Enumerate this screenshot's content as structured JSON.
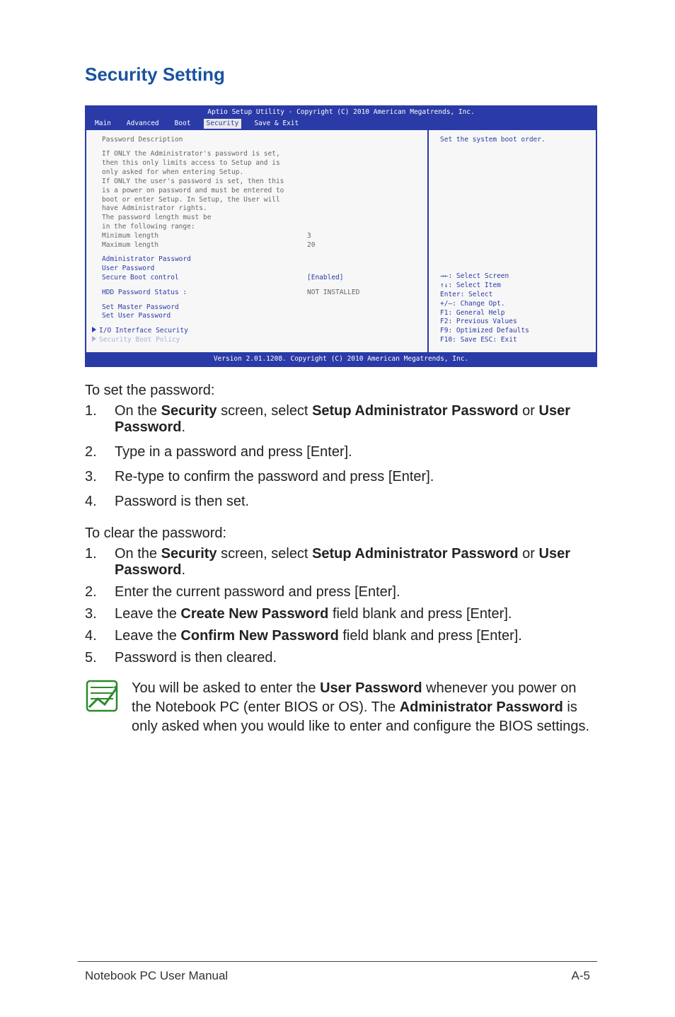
{
  "title": "Security Setting",
  "bios": {
    "header_title": "Aptio Setup Utility - Copyright (C) 2010 American Megatrends, Inc.",
    "menu": [
      "Main",
      "Advanced",
      "Boot",
      "Security",
      "Save & Exit"
    ],
    "active_tab": "Security",
    "left": {
      "heading": "Password Description",
      "desc_lines": [
        "If ONLY the Administrator's password is set,",
        "then this only limits access to Setup and is",
        "only asked for when entering Setup.",
        "If ONLY the user's password is set, then this",
        "is a power on password and must be entered to",
        "boot or enter Setup. In Setup, the User will",
        "have Administrator rights.",
        "The password length must be",
        "in the following range:"
      ],
      "min_label": "Minimum length",
      "min_value": "3",
      "max_label": "Maximum length",
      "max_value": "20",
      "items": [
        "Administrator Password",
        "User Password"
      ],
      "secure_boot_label": "Secure Boot control",
      "secure_boot_value": "[Enabled]",
      "hdd_label": "HDD Password Status :",
      "hdd_value": "NOT INSTALLED",
      "set_master": "Set Master Password",
      "set_user": "Set User Password",
      "io_sec": "I/O Interface Security",
      "boot_policy": "Security Boot Policy"
    },
    "right": {
      "top": "Set the system boot order.",
      "keys": [
        "→←: Select Screen",
        "↑↓:   Select Item",
        "Enter: Select",
        "+/—:  Change Opt.",
        "F1:   General Help",
        "F2:   Previous Values",
        "F9:   Optimized Defaults",
        "F10:  Save   ESC: Exit"
      ]
    },
    "footer": "Version 2.01.1208. Copyright (C) 2010 American Megatrends, Inc."
  },
  "set_lead": "To set the password:",
  "set_steps": {
    "s1a": "On the ",
    "s1b": "Security",
    "s1c": " screen, select ",
    "s1d": "Setup Administrator Password",
    "s1e": " or ",
    "s1f": "User Password",
    "s1g": ".",
    "s2": "Type in a password and press [Enter].",
    "s3": "Re-type to confirm the password and press [Enter].",
    "s4": "Password is then set."
  },
  "clear_lead": "To clear the password:",
  "clear_steps": {
    "s1a": "On the ",
    "s1b": "Security",
    "s1c": " screen, select ",
    "s1d": "Setup Administrator Password",
    "s1e": " or ",
    "s1f": "User Password",
    "s1g": ".",
    "s2": "Enter the current password and press [Enter].",
    "s3a": "Leave the ",
    "s3b": "Create New Password",
    "s3c": " field blank and press [Enter].",
    "s4a": "Leave the ",
    "s4b": "Confirm New Password",
    "s4c": " field blank and press [Enter].",
    "s5": "Password is then cleared."
  },
  "note": {
    "p1": "You will be asked to enter the ",
    "b1": "User Password",
    "p2": " whenever you power on the Notebook PC (enter BIOS or OS). The ",
    "b2": "Administrator Password",
    "p3": " is only asked when you would like to enter and configure the BIOS settings."
  },
  "nums": {
    "n1": "1.",
    "n2": "2.",
    "n3": "3.",
    "n4": "4.",
    "n5": "5."
  },
  "footer_left": "Notebook PC User Manual",
  "footer_right": "A-5"
}
